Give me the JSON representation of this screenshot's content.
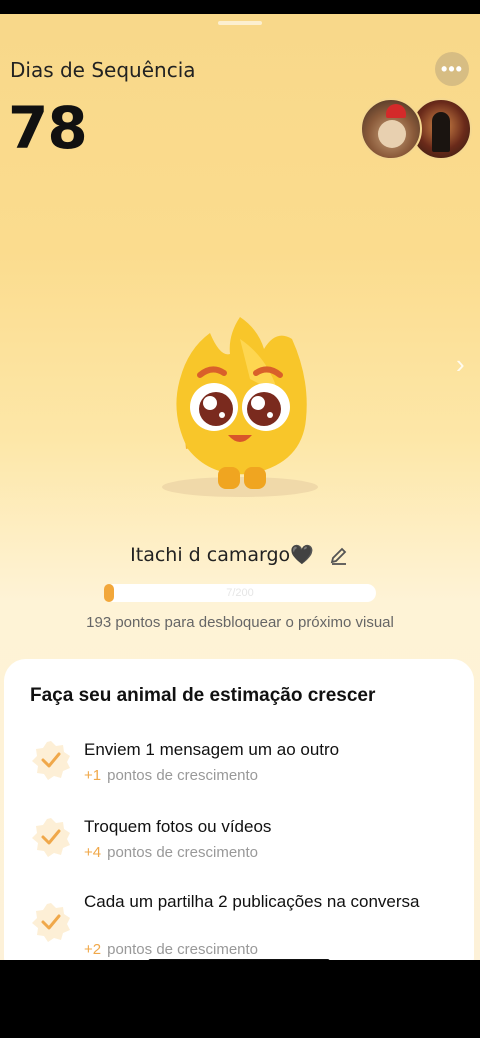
{
  "header": {
    "streak_label": "Dias de Sequência",
    "streak_count": "78",
    "more_icon": "more-horizontal-icon"
  },
  "pet": {
    "name": "Itachi d camargo🖤",
    "progress_text": "7/200",
    "progress_fraction": 0.035,
    "caption": "193 pontos para desbloquear o próximo visual"
  },
  "growth_card": {
    "title": "Faça seu animal de estimação crescer",
    "tasks": [
      {
        "title": "Enviem 1 mensagem um ao outro",
        "points": "+1",
        "subtitle": "pontos de crescimento"
      },
      {
        "title": "Troquem fotos ou vídeos",
        "points": "+4",
        "subtitle": "pontos de crescimento"
      },
      {
        "title": "Cada um partilha 2 publicações na conversa",
        "points": "+2",
        "subtitle": "pontos de crescimento"
      }
    ]
  },
  "colors": {
    "accent_orange": "#f2a73a",
    "background_top": "#f8d88a",
    "card": "#ffffff"
  }
}
